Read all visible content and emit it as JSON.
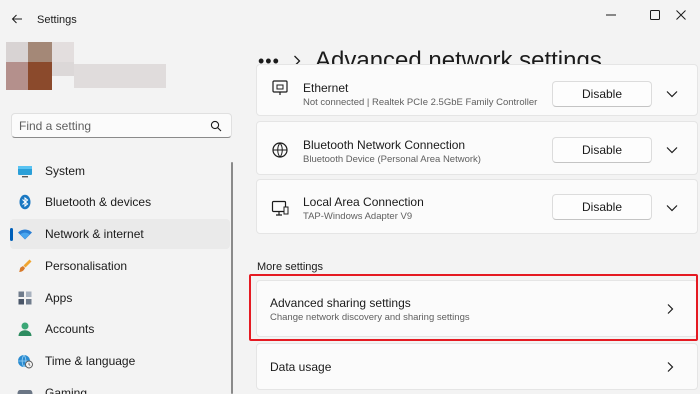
{
  "window": {
    "title": "Settings"
  },
  "search": {
    "placeholder": "Find a setting"
  },
  "sidebar": {
    "items": [
      {
        "label": "System",
        "icon": "monitor-icon"
      },
      {
        "label": "Bluetooth & devices",
        "icon": "bluetooth-icon"
      },
      {
        "label": "Network & internet",
        "icon": "wifi-icon",
        "active": true
      },
      {
        "label": "Personalisation",
        "icon": "paintbrush-icon"
      },
      {
        "label": "Apps",
        "icon": "apps-icon"
      },
      {
        "label": "Accounts",
        "icon": "person-icon"
      },
      {
        "label": "Time & language",
        "icon": "globe-clock-icon"
      },
      {
        "label": "Gaming",
        "icon": "gamepad-icon"
      }
    ]
  },
  "breadcrumb": {
    "ellipsis": "•••",
    "title": "Advanced network settings"
  },
  "adapters": [
    {
      "name": "Ethernet",
      "description": "Not connected | Realtek PCIe 2.5GbE Family Controller",
      "button": "Disable",
      "icon": "ethernet-icon"
    },
    {
      "name": "Bluetooth Network Connection",
      "description": "Bluetooth Device (Personal Area Network)",
      "button": "Disable",
      "icon": "globe-icon"
    },
    {
      "name": "Local Area Connection",
      "description": "TAP-Windows Adapter V9",
      "button": "Disable",
      "icon": "monitor-icon"
    }
  ],
  "more_settings": {
    "heading": "More settings",
    "items": [
      {
        "title": "Advanced sharing settings",
        "subtitle": "Change network discovery and sharing settings"
      },
      {
        "title": "Data usage"
      }
    ]
  },
  "colors": {
    "accent": "#005fb8",
    "highlight_box": "#e51a22",
    "background": "#f3f3f3"
  }
}
